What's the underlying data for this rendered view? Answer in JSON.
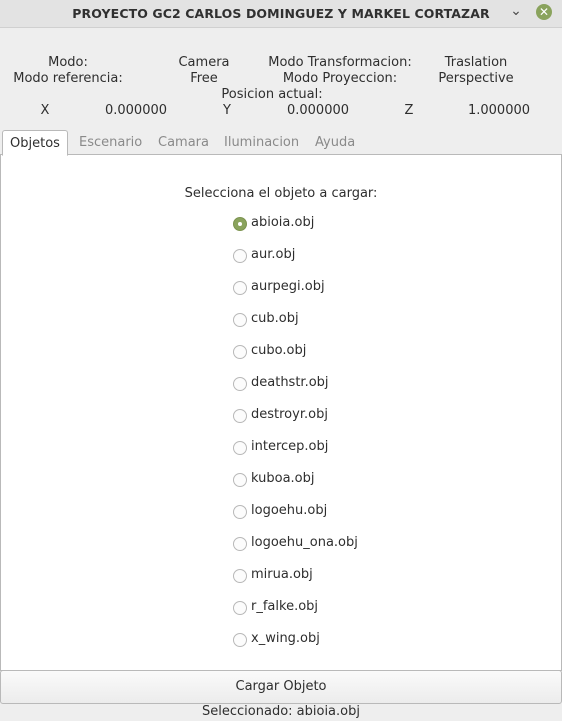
{
  "window": {
    "title": "PROYECTO GC2 CARLOS DOMINGUEZ Y MARKEL CORTAZAR",
    "minimize_glyph": "⌄",
    "close_glyph": "✕",
    "accent_color": "#8aa35d"
  },
  "info": {
    "modo_label": "Modo:",
    "modo_value": "Camera",
    "modo_transformacion_label": "Modo Transformacion:",
    "modo_transformacion_value": "Traslation",
    "modo_referencia_label": "Modo referencia:",
    "modo_referencia_value": "Free",
    "modo_proyeccion_label": "Modo Proyeccion:",
    "modo_proyeccion_value": "Perspective",
    "posicion_label": "Posicion actual:",
    "x_label": "X",
    "x_value": "0.000000",
    "y_label": "Y",
    "y_value": "0.000000",
    "z_label": "Z",
    "z_value": "1.000000"
  },
  "tabs": [
    {
      "label": "Objetos",
      "active": true
    },
    {
      "label": "Escenario",
      "active": false
    },
    {
      "label": "Camara",
      "active": false
    },
    {
      "label": "Iluminacion",
      "active": false
    },
    {
      "label": "Ayuda",
      "active": false
    }
  ],
  "objetos": {
    "prompt": "Selecciona el objeto a cargar:",
    "selected": "abioia.obj",
    "options": [
      "abioia.obj",
      "aur.obj",
      "aurpegi.obj",
      "cub.obj",
      "cubo.obj",
      "deathstr.obj",
      "destroyr.obj",
      "intercep.obj",
      "kuboa.obj",
      "logoehu.obj",
      "logoehu_ona.obj",
      "mirua.obj",
      "r_falke.obj",
      "x_wing.obj"
    ],
    "load_button": "Cargar Objeto",
    "status": "Seleccionado: abioia.obj"
  }
}
